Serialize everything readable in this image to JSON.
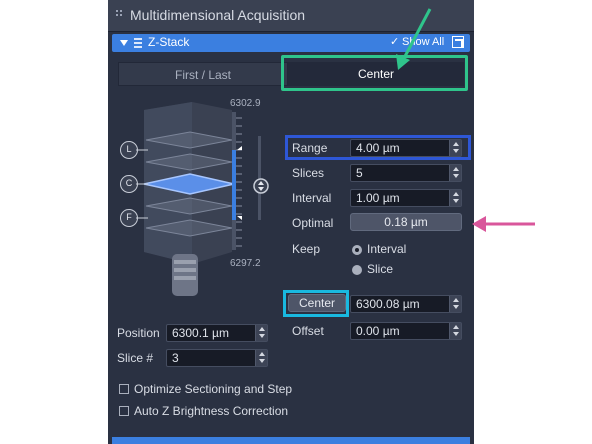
{
  "panel": {
    "title": "Multidimensional Acquisition"
  },
  "zstack": {
    "title": "Z-Stack",
    "show_all": "Show All",
    "check": "✓"
  },
  "tabs": [
    {
      "label": "First / Last"
    },
    {
      "label": "Center"
    }
  ],
  "scale": {
    "top": "6302.9",
    "bottom": "6297.2"
  },
  "focus_markers": [
    "L",
    "C",
    "F"
  ],
  "settings": {
    "range_label": "Range",
    "range_value": "4.00 µm",
    "slices_label": "Slices",
    "slices_value": "5",
    "interval_label": "Interval",
    "interval_value": "1.00 µm",
    "optimal_label": "Optimal",
    "optimal_value": "0.18 µm",
    "keep_label": "Keep",
    "keep_interval": "Interval",
    "keep_slice": "Slice",
    "center_button": "Center",
    "center_value": "6300.08 µm",
    "offset_label": "Offset",
    "offset_value": "0.00 µm"
  },
  "position": {
    "label": "Position",
    "value": "6300.1 µm"
  },
  "slice_num": {
    "label": "Slice #",
    "value": "3"
  },
  "options": {
    "optimize": "Optimize Sectioning and Step",
    "auto_z": "Auto Z Brightness Correction"
  },
  "colors": {
    "accent_blue": "#3b7fe0",
    "highlight_green": "#2fc48b",
    "highlight_blue": "#2e57d6",
    "highlight_cyan": "#19b9e0",
    "arrow_pink": "#d9569b",
    "arrow_green": "#2fc48b"
  }
}
